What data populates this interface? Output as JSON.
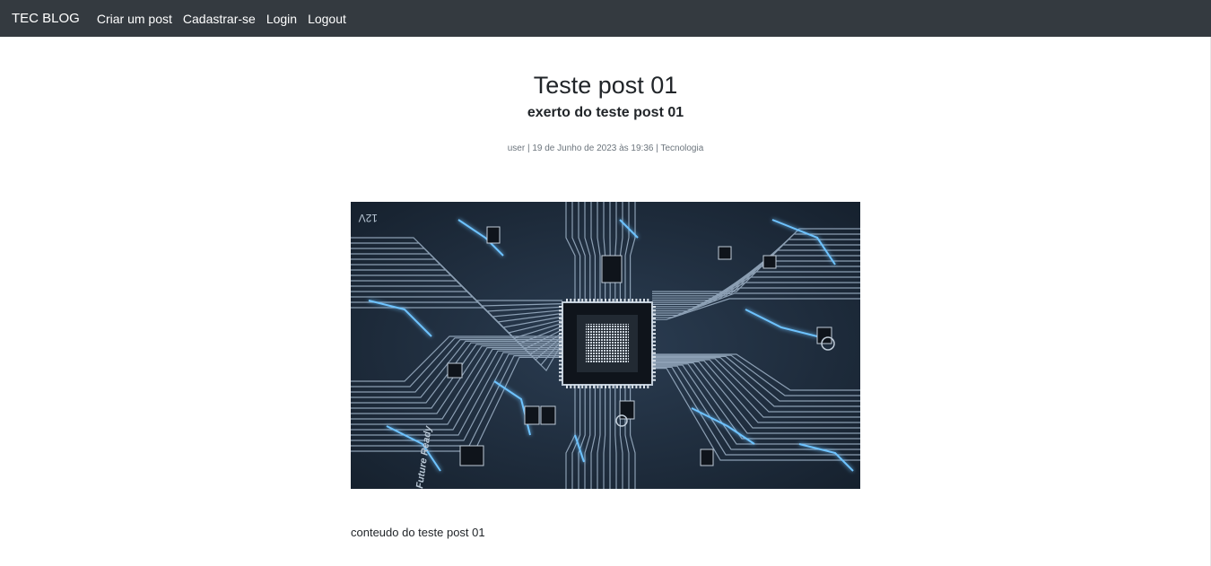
{
  "navbar": {
    "brand": "TEC BLOG",
    "links": [
      "Criar um post",
      "Cadastrar-se",
      "Login",
      "Logout"
    ]
  },
  "post": {
    "title": "Teste post 01",
    "excerpt": "exerto do teste post 01",
    "meta": {
      "author": "user",
      "separator": " | ",
      "date": "19 de Junho de 2023 às 19:36",
      "category": "Tecnologia"
    },
    "image": {
      "description_icon": "circuit-board-image",
      "text_marks": [
        "12V",
        "Future Ready"
      ]
    },
    "content": "conteudo do teste post 01"
  },
  "colors": {
    "navbar_bg": "#343a40",
    "navbar_text": "#ffffff",
    "meta_text": "#6c757d",
    "circuit_bg": "#1c2a3b",
    "circuit_glow": "#6ec3ff"
  }
}
